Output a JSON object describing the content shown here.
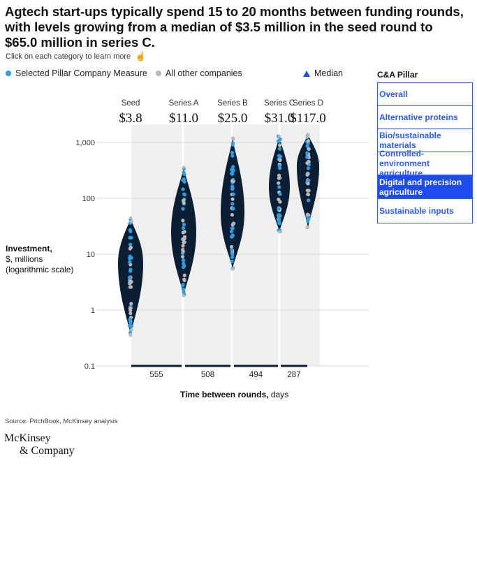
{
  "title": "Agtech start-ups typically spend 15 to 20 months between funding rounds, with levels growing from a median of $3.5 million in the seed round to $65.0 million in series C.",
  "hint": "Click on each category to learn more",
  "legend": {
    "selected": "Selected Pillar Company Measure",
    "other": "All other companies",
    "median": "Median",
    "colors": {
      "selected": "#2b9fe6",
      "other": "#b9b9b9",
      "median": "#1f4cf0",
      "violin": "#0c1e33"
    }
  },
  "pillar": {
    "heading": "C&A Pillar",
    "items": [
      "Overall",
      "Alternative proteins",
      "Bio/sustainable materials",
      "Controlled-environment agriculture",
      "Digital and precision agriculture",
      "Sustainable inputs"
    ],
    "selected": "Digital and precision agriculture"
  },
  "y_axis": {
    "label_bold": "Investment,",
    "label_rest1": "$, millions",
    "label_rest2": "(logarithmic scale)"
  },
  "x_axis": {
    "label_bold": "Time between rounds,",
    "label_rest": "days"
  },
  "source": "Source: PitchBook, McKinsey analysis",
  "logo": {
    "line1": "McKinsey",
    "line2": "& Company"
  },
  "chart_data": {
    "type": "violin",
    "y_scale": "log",
    "ylim": [
      0.1,
      2000
    ],
    "yticks": [
      0.1,
      1,
      10,
      100,
      1000
    ],
    "ytick_labels": [
      "0.1",
      "1",
      "10",
      "100",
      "1,000"
    ],
    "categories": [
      "Seed",
      "Series A",
      "Series B",
      "Series C",
      "Series D"
    ],
    "medians": [
      "$3.8",
      "$11.0",
      "$25.0",
      "$31.0",
      "$117.0"
    ],
    "distributions": [
      {
        "category": "Seed",
        "min": 0.35,
        "max": 45,
        "center": 7
      },
      {
        "category": "Series A",
        "min": 1.8,
        "max": 360,
        "center": 25
      },
      {
        "category": "Series B",
        "min": 5.5,
        "max": 1200,
        "center": 55
      },
      {
        "category": "Series C",
        "min": 25,
        "max": 1300,
        "center": 160
      },
      {
        "category": "Series D",
        "min": 30,
        "max": 1400,
        "center": 380
      }
    ],
    "days_between_rounds": [
      {
        "between": [
          "Seed",
          "Series A"
        ],
        "days": 555
      },
      {
        "between": [
          "Series A",
          "Series B"
        ],
        "days": 508
      },
      {
        "between": [
          "Series B",
          "Series C"
        ],
        "days": 494
      },
      {
        "between": [
          "Series C",
          "Series D"
        ],
        "days": 287
      }
    ]
  }
}
